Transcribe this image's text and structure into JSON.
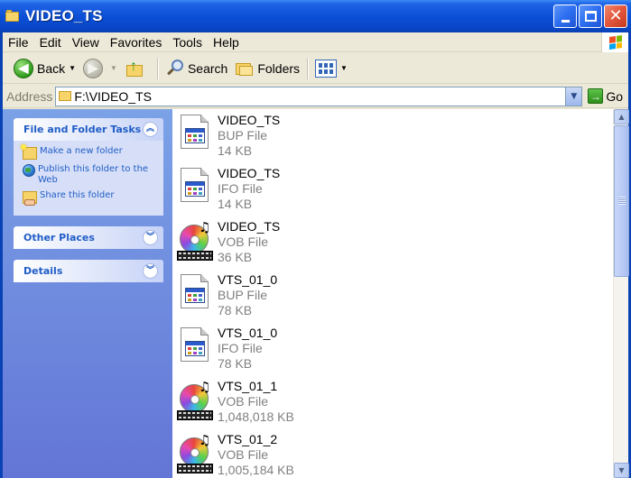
{
  "window": {
    "title": "VIDEO_TS"
  },
  "menu": [
    "File",
    "Edit",
    "View",
    "Favorites",
    "Tools",
    "Help"
  ],
  "toolbar": {
    "back_label": "Back",
    "search_label": "Search",
    "folders_label": "Folders"
  },
  "address": {
    "label": "Address",
    "value": "F:\\VIDEO_TS",
    "go_label": "Go"
  },
  "taskpane": {
    "file_folder_tasks": {
      "title": "File and Folder Tasks",
      "items": [
        "Make a new folder",
        "Publish this folder to the Web",
        "Share this folder"
      ]
    },
    "other_places": {
      "title": "Other Places"
    },
    "details": {
      "title": "Details"
    }
  },
  "files": [
    {
      "name": "VIDEO_TS",
      "type": "BUP File",
      "size": "14 KB",
      "icon": "document-icon"
    },
    {
      "name": "VIDEO_TS",
      "type": "IFO File",
      "size": "14 KB",
      "icon": "document-icon"
    },
    {
      "name": "VIDEO_TS",
      "type": "VOB File",
      "size": "36 KB",
      "icon": "media-disc-icon"
    },
    {
      "name": "VTS_01_0",
      "type": "BUP File",
      "size": "78 KB",
      "icon": "document-icon"
    },
    {
      "name": "VTS_01_0",
      "type": "IFO File",
      "size": "78 KB",
      "icon": "document-icon"
    },
    {
      "name": "VTS_01_1",
      "type": "VOB File",
      "size": "1,048,018 KB",
      "icon": "media-disc-icon"
    },
    {
      "name": "VTS_01_2",
      "type": "VOB File",
      "size": "1,005,184 KB",
      "icon": "media-disc-icon"
    }
  ],
  "colors": {
    "titlebar": "#0a4ed6",
    "taskpane_link": "#215dc6",
    "close_button": "#e1553b"
  }
}
